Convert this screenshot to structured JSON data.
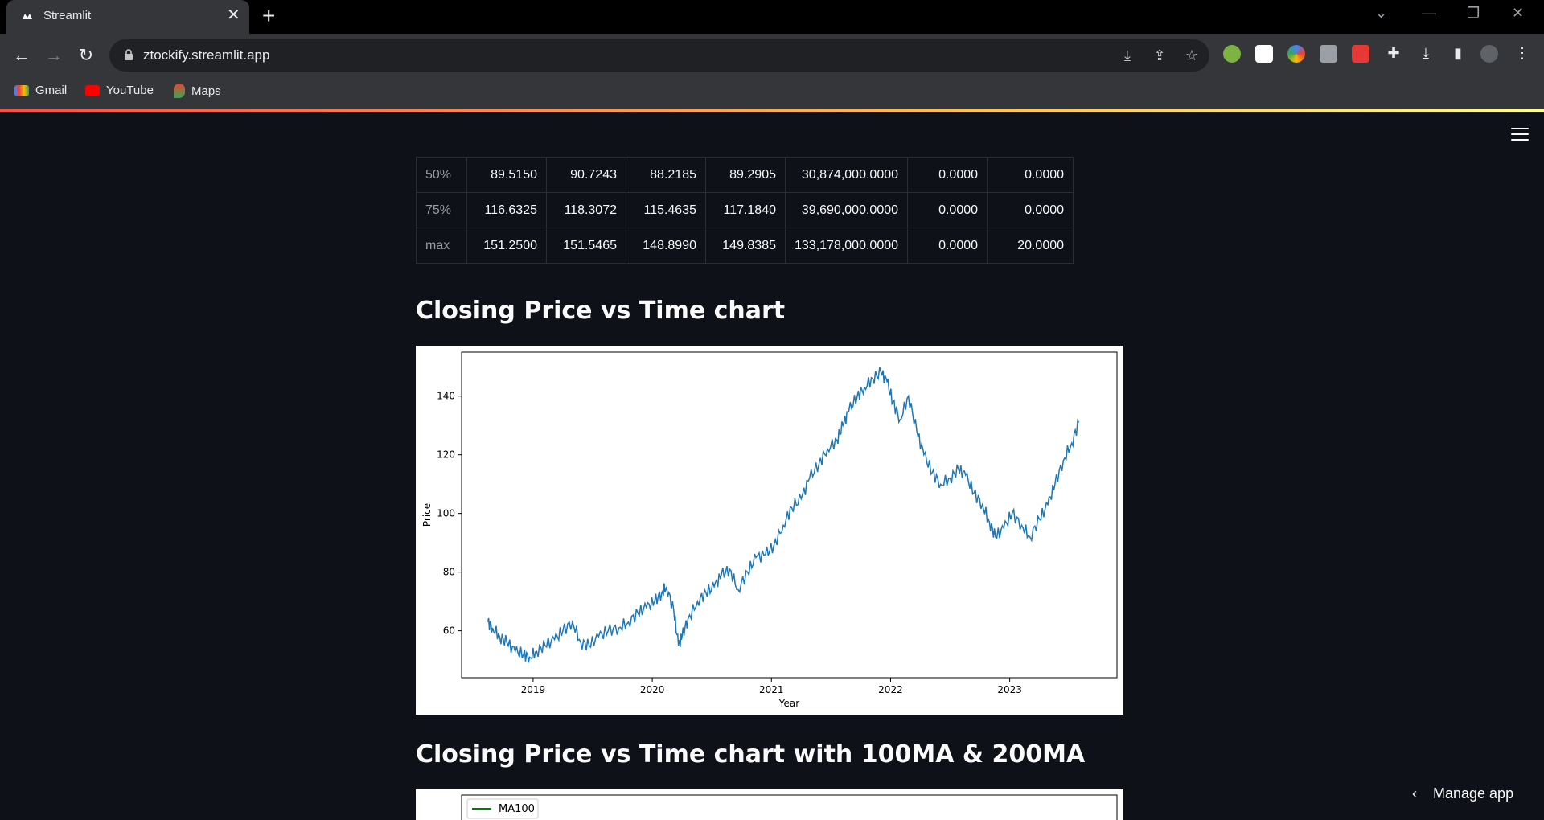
{
  "browser": {
    "tab_title": "Streamlit",
    "url": "ztockify.streamlit.app",
    "bookmarks": [
      "Gmail",
      "YouTube",
      "Maps"
    ]
  },
  "table": {
    "rows": [
      {
        "label": "50%",
        "values": [
          "89.5150",
          "90.7243",
          "88.2185",
          "89.2905",
          "30,874,000.0000",
          "0.0000",
          "0.0000"
        ]
      },
      {
        "label": "75%",
        "values": [
          "116.6325",
          "118.3072",
          "115.4635",
          "117.1840",
          "39,690,000.0000",
          "0.0000",
          "0.0000"
        ]
      },
      {
        "label": "max",
        "values": [
          "151.2500",
          "151.5465",
          "148.8990",
          "149.8385",
          "133,178,000.0000",
          "0.0000",
          "20.0000"
        ]
      }
    ]
  },
  "section1_title": "Closing Price vs Time chart",
  "section2_title": "Closing Price vs Time chart with 100MA & 200MA",
  "manage_app": "Manage app",
  "colors": {
    "line": "#1f77b4",
    "ma100": "#008000",
    "bg": "#0e1117"
  },
  "chart_data": [
    {
      "type": "line",
      "title": "",
      "xlabel": "Year",
      "ylabel": "Price",
      "xlim": [
        2018.4,
        2023.9
      ],
      "ylim": [
        44,
        155
      ],
      "xticks": [
        2019,
        2020,
        2021,
        2022,
        2023
      ],
      "yticks": [
        60,
        80,
        100,
        120,
        140
      ],
      "series": [
        {
          "x": [
            2018.62,
            2018.66,
            2018.72,
            2018.78,
            2018.85,
            2018.92,
            2018.97,
            2019.03,
            2019.1,
            2019.18,
            2019.25,
            2019.33,
            2019.4,
            2019.47,
            2019.55,
            2019.63,
            2019.72,
            2019.8,
            2019.88,
            2019.95,
            2020.02,
            2020.08,
            2020.12,
            2020.18,
            2020.22,
            2020.25,
            2020.3,
            2020.38,
            2020.45,
            2020.52,
            2020.58,
            2020.65,
            2020.72,
            2020.8,
            2020.87,
            2020.95,
            2021.02,
            2021.1,
            2021.17,
            2021.25,
            2021.32,
            2021.4,
            2021.47,
            2021.55,
            2021.6,
            2021.65,
            2021.72,
            2021.78,
            2021.85,
            2021.92,
            2021.97,
            2022.02,
            2022.08,
            2022.15,
            2022.22,
            2022.28,
            2022.35,
            2022.42,
            2022.5,
            2022.57,
            2022.63,
            2022.7,
            2022.77,
            2022.83,
            2022.88,
            2022.95,
            2023.02,
            2023.1,
            2023.17,
            2023.25,
            2023.32,
            2023.38,
            2023.45,
            2023.52,
            2023.58
          ],
          "y": [
            63,
            61,
            58,
            56,
            53,
            52,
            51,
            53,
            55,
            57,
            60,
            63,
            56,
            55,
            58,
            60,
            61,
            63,
            66,
            68,
            70,
            73,
            75,
            67,
            55,
            58,
            64,
            70,
            73,
            75,
            79,
            81,
            74,
            80,
            85,
            86,
            89,
            96,
            102,
            105,
            112,
            117,
            122,
            125,
            130,
            135,
            140,
            143,
            146,
            148,
            145,
            138,
            132,
            140,
            128,
            120,
            114,
            110,
            112,
            115,
            113,
            107,
            103,
            97,
            92,
            95,
            100,
            96,
            92,
            98,
            103,
            110,
            118,
            124,
            131
          ]
        }
      ]
    },
    {
      "type": "line",
      "title": "",
      "legend": [
        "MA100"
      ]
    }
  ]
}
